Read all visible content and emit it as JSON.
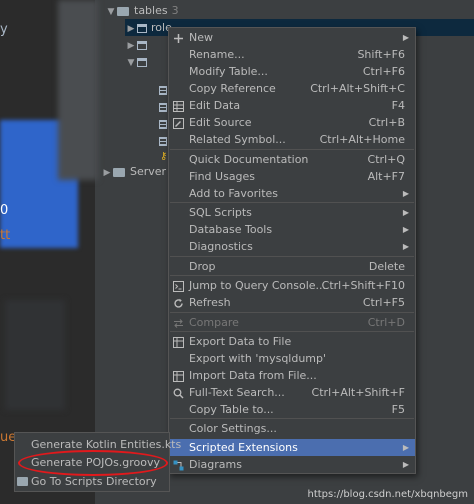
{
  "tree": {
    "tables_label": "tables",
    "tables_count": "3",
    "row_role_label": "role",
    "server_label": "Server C"
  },
  "editor": {
    "fragments": [
      {
        "text": "y"
      },
      {
        "text": "0"
      },
      {
        "text": "tt"
      },
      {
        "text": "ue"
      }
    ]
  },
  "menu": {
    "items": [
      {
        "label": "New",
        "shortcut": "",
        "submenu": true,
        "icon": "plus-icon"
      },
      {
        "label": "Rename...",
        "shortcut": "Shift+F6",
        "submenu": false,
        "icon": ""
      },
      {
        "label": "Modify Table...",
        "shortcut": "Ctrl+F6",
        "submenu": false,
        "icon": ""
      },
      {
        "label": "Copy Reference",
        "shortcut": "Ctrl+Alt+Shift+C",
        "submenu": false,
        "icon": ""
      },
      {
        "label": "Edit Data",
        "shortcut": "F4",
        "submenu": false,
        "icon": "table-grid-icon"
      },
      {
        "label": "Edit Source",
        "shortcut": "Ctrl+B",
        "submenu": false,
        "icon": "edit-pencil-icon"
      },
      {
        "label": "Related Symbol...",
        "shortcut": "Ctrl+Alt+Home",
        "submenu": false,
        "icon": ""
      },
      {
        "label": "Quick Documentation",
        "shortcut": "Ctrl+Q",
        "submenu": false,
        "icon": ""
      },
      {
        "label": "Find Usages",
        "shortcut": "Alt+F7",
        "submenu": false,
        "icon": ""
      },
      {
        "label": "Add to Favorites",
        "shortcut": "",
        "submenu": true,
        "icon": ""
      },
      {
        "label": "SQL Scripts",
        "shortcut": "",
        "submenu": true,
        "icon": ""
      },
      {
        "label": "Database Tools",
        "shortcut": "",
        "submenu": true,
        "icon": ""
      },
      {
        "label": "Diagnostics",
        "shortcut": "",
        "submenu": true,
        "icon": ""
      },
      {
        "label": "Drop",
        "shortcut": "Delete",
        "submenu": false,
        "icon": ""
      },
      {
        "label": "Jump to Query Console...",
        "shortcut": "Ctrl+Shift+F10",
        "submenu": false,
        "icon": "console-icon"
      },
      {
        "label": "Refresh",
        "shortcut": "Ctrl+F5",
        "submenu": false,
        "icon": "refresh-icon"
      },
      {
        "label": "Compare",
        "shortcut": "Ctrl+D",
        "submenu": false,
        "icon": "compare-icon"
      },
      {
        "label": "Export Data to File",
        "shortcut": "",
        "submenu": false,
        "icon": "export-icon"
      },
      {
        "label": "Export with 'mysqldump'",
        "shortcut": "",
        "submenu": false,
        "icon": ""
      },
      {
        "label": "Import Data from File...",
        "shortcut": "",
        "submenu": false,
        "icon": "import-icon"
      },
      {
        "label": "Full-Text Search...",
        "shortcut": "Ctrl+Alt+Shift+F",
        "submenu": false,
        "icon": "search-icon"
      },
      {
        "label": "Copy Table to...",
        "shortcut": "F5",
        "submenu": false,
        "icon": ""
      },
      {
        "label": "Color Settings...",
        "shortcut": "",
        "submenu": false,
        "icon": ""
      },
      {
        "label": "Scripted Extensions",
        "shortcut": "",
        "submenu": true,
        "icon": ""
      },
      {
        "label": "Diagrams",
        "shortcut": "",
        "submenu": true,
        "icon": "diagram-icon"
      }
    ]
  },
  "submenu": {
    "items": [
      {
        "label": "Generate Kotlin Entities.kts"
      },
      {
        "label": "Generate POJOs.groovy"
      },
      {
        "label": "Go To Scripts Directory"
      }
    ]
  },
  "watermark": "https://blog.csdn.net/xbqnbegm",
  "colors": {
    "menu_bg": "#3c3f41",
    "selection": "#4b6eaf",
    "annotation_oval": "#e1191c",
    "editor_selection": "#2f65ca"
  }
}
